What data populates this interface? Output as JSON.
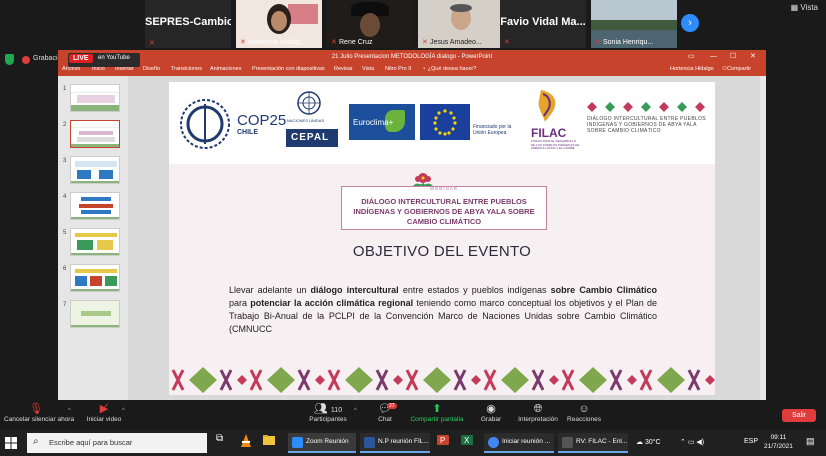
{
  "zoom": {
    "participants": [
      {
        "name": "SEPRES-Cambio...",
        "muted": true,
        "style": "name-only"
      },
      {
        "name": "Hortencia Hidalg...",
        "muted": true,
        "style": "video"
      },
      {
        "name": "Rene Cruz",
        "muted": true,
        "style": "video"
      },
      {
        "name": "Jesus Amadeo...",
        "muted": true,
        "style": "video"
      },
      {
        "name": "Favio Vidal Ma...",
        "muted": true,
        "style": "name-only"
      },
      {
        "name": "Sonia Henriqu...",
        "muted": true,
        "style": "video"
      }
    ],
    "view_label": "Vista",
    "recording_label": "Grabación",
    "controls": {
      "mute_label": "Cancelar silenciar ahora",
      "video_label": "Iniciar video",
      "participants_label": "Participantes",
      "participants_count": "110",
      "chat_label": "Chat",
      "chat_badge": "27",
      "share_label": "Compartir pantalla",
      "record_label": "Grabar",
      "interpretation_label": "Interpretación",
      "reactions_label": "Reacciones",
      "leave_label": "Salir"
    }
  },
  "powerpoint": {
    "window_title": "21 Julio Presentacion METODOLOGÍA dialogo - PowerPoint",
    "live_label": "LIVE",
    "live_platform": "en YouTube",
    "ribbon_tabs": [
      "Archivo",
      "Inicio",
      "Insertar",
      "Diseño",
      "Transiciones",
      "Animaciones",
      "Presentación con diapositivas",
      "Revisar",
      "Vista",
      "Nitro Pro 9"
    ],
    "tell_me": "¿Qué desea hacer?",
    "user_name": "Hortencia Hidalgo",
    "share_label": "Compartir",
    "slide_numbers": [
      "1",
      "2",
      "3",
      "4",
      "5",
      "6",
      "7"
    ],
    "active_slide": 2
  },
  "slide": {
    "logos": {
      "cop_text": "COP25",
      "cop_sub": "CHILE",
      "un_text": "NACIONES UNIDAS",
      "cepal_text": "CEPAL",
      "euroclima_text": "Euroclima+",
      "eu_text": "Financiado por la Unión Europea",
      "filac_text": "FILAC",
      "filac_sub": "FONDO PARA EL DESARROLLO DE LOS PUEBLOS INDÍGENAS DE AMÉRICA LATINA Y EL CARIBE",
      "dialog_logo_text": "DIÁLOGO INTERCULTURAL ENTRE PUEBLOS INDÍGENAS Y GOBIERNOS DE ABYA YALA SOBRE CAMBIO CLIMÁTICO"
    },
    "webinar_label": "WEBINAR",
    "webinar_title": "DIÁLOGO INTERCULTURAL ENTRE PUEBLOS INDÍGENAS Y GOBIERNOS DE ABYA YALA SOBRE CAMBIO CLIMÁTICO",
    "heading": "OBJETIVO DEL EVENTO",
    "body_parts": [
      {
        "text": "Llevar adelante un ",
        "bold": false
      },
      {
        "text": "diálogo intercultural",
        "bold": true
      },
      {
        "text": " entre estados y pueblos indígenas ",
        "bold": false
      },
      {
        "text": "sobre Cambio Climático",
        "bold": true
      },
      {
        "text": " para ",
        "bold": false
      },
      {
        "text": "potenciar la acción climática regional",
        "bold": true
      },
      {
        "text": " teniendo como marco conceptual los objetivos y el Plan de Trabajo Bi-Anual de la PCLPI de la Convención Marco de Naciones Unidas sobre Cambio Climático (CMNUCC",
        "bold": false
      }
    ]
  },
  "taskbar": {
    "search_placeholder": "Escribe aquí para buscar",
    "apps": [
      {
        "label": "Zoom Reunión",
        "color": "#2d8cff"
      },
      {
        "label": "N.P reunión FIL...",
        "color": "#2b579a"
      },
      {
        "label": "Iniciar reunión ...",
        "color": "#4285f4"
      },
      {
        "label": "RV: FILAC - Enl...",
        "color": "#555555"
      }
    ],
    "weather": "30°C",
    "language": "ESP",
    "time": "09:11",
    "date": "21/7/2021"
  },
  "colors": {
    "ppt_accent": "#c8432c",
    "zoom_blue": "#2d8cff",
    "leave_red": "#e03c3c",
    "share_green": "#1fd15a",
    "webinar_purple": "#7b3a6b"
  }
}
